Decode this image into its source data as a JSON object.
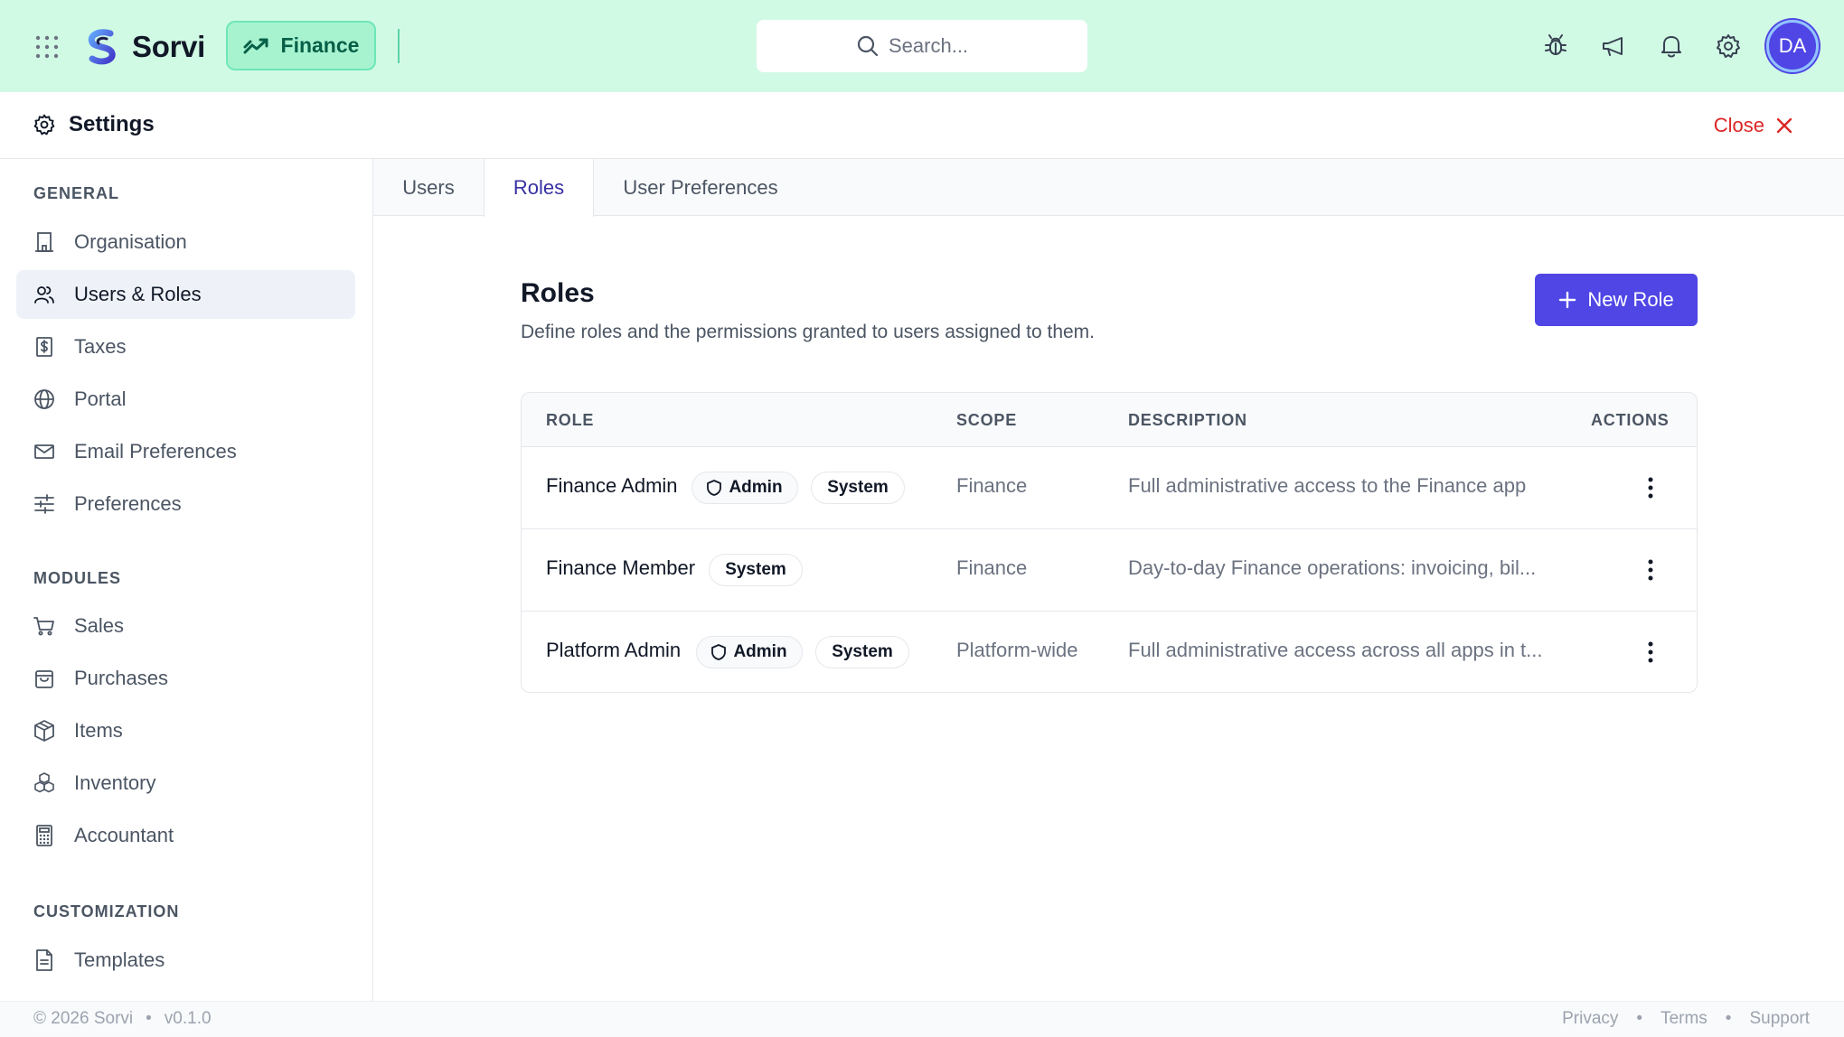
{
  "app": {
    "brand": "Sorvi",
    "current_app": "Finance",
    "user_initials": "DA"
  },
  "search": {
    "placeholder": "Search..."
  },
  "top_icons": [
    "bug-icon",
    "megaphone-icon",
    "bell-icon",
    "gear-icon"
  ],
  "settings": {
    "title": "Settings",
    "close_label": "Close"
  },
  "sidebar": {
    "sections": [
      {
        "label": "GENERAL",
        "items": [
          {
            "label": "Organisation",
            "icon": "building-icon"
          },
          {
            "label": "Users & Roles",
            "icon": "users-icon",
            "active": true
          },
          {
            "label": "Taxes",
            "icon": "dollar-receipt-icon"
          },
          {
            "label": "Portal",
            "icon": "globe-icon"
          },
          {
            "label": "Email Preferences",
            "icon": "mail-icon"
          },
          {
            "label": "Preferences",
            "icon": "sliders-icon"
          }
        ]
      },
      {
        "label": "MODULES",
        "items": [
          {
            "label": "Sales",
            "icon": "cart-icon"
          },
          {
            "label": "Purchases",
            "icon": "bag-icon"
          },
          {
            "label": "Items",
            "icon": "package-icon"
          },
          {
            "label": "Inventory",
            "icon": "boxes-icon"
          },
          {
            "label": "Accountant",
            "icon": "calculator-icon"
          }
        ]
      },
      {
        "label": "CUSTOMIZATION",
        "items": [
          {
            "label": "Templates",
            "icon": "document-icon"
          }
        ]
      }
    ]
  },
  "tabs": [
    {
      "label": "Users"
    },
    {
      "label": "Roles",
      "active": true
    },
    {
      "label": "User Preferences"
    }
  ],
  "roles_page": {
    "title": "Roles",
    "description": "Define roles and the permissions granted to users assigned to them.",
    "new_role_label": "New Role",
    "columns": [
      "ROLE",
      "SCOPE",
      "DESCRIPTION",
      "ACTIONS"
    ],
    "rows": [
      {
        "name": "Finance Admin",
        "admin_badge": "Admin",
        "system_badge": "System",
        "scope": "Finance",
        "description": "Full administrative access to the Finance app"
      },
      {
        "name": "Finance Member",
        "admin_badge": "",
        "system_badge": "System",
        "scope": "Finance",
        "description": "Day-to-day Finance operations: invoicing, bil..."
      },
      {
        "name": "Platform Admin",
        "admin_badge": "Admin",
        "system_badge": "System",
        "scope": "Platform-wide",
        "description": "Full administrative access across all apps in t..."
      }
    ]
  },
  "footer": {
    "copyright": "© 2026 Sorvi",
    "separator": "•",
    "version": "v0.1.0",
    "links": [
      "Privacy",
      "Terms",
      "Support"
    ]
  },
  "colors": {
    "topbar_bg": "#d1fae5",
    "accent": "#4f46e5",
    "close_red": "#dc2626",
    "finance_green": "#065f46"
  }
}
